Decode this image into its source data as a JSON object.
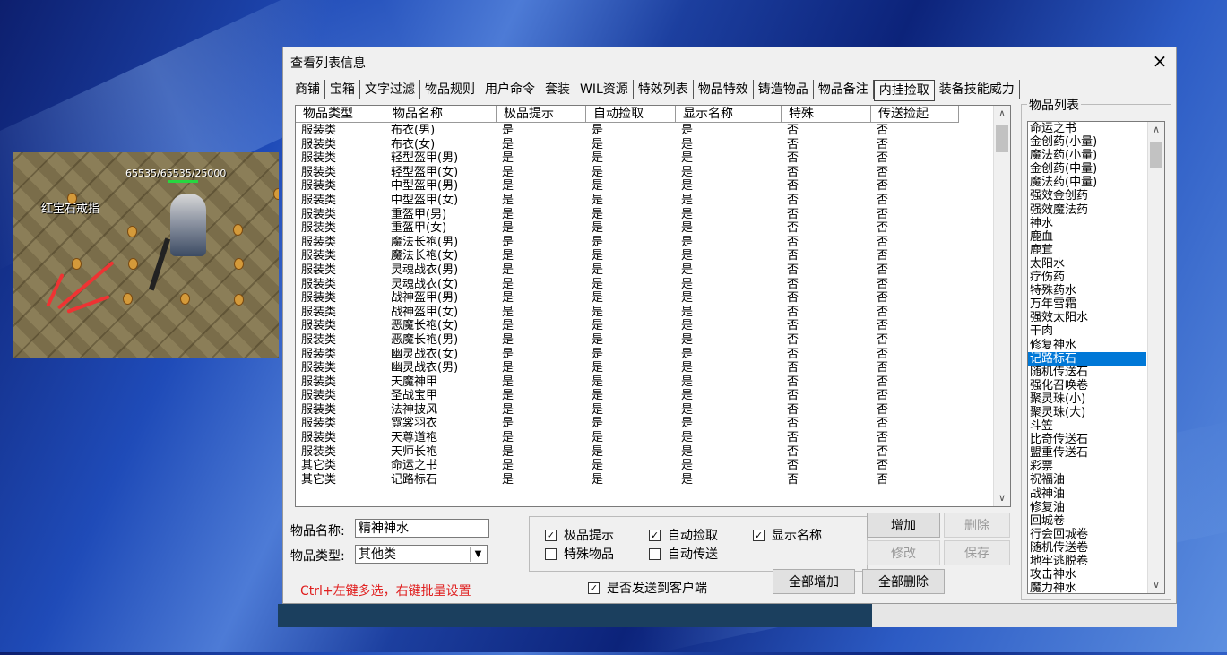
{
  "window": {
    "title": "查看列表信息",
    "close_glyph": "×"
  },
  "tabs": [
    "商铺",
    "宝箱",
    "文字过滤",
    "物品规则",
    "用户命令",
    "套装",
    "WIL资源",
    "特效列表",
    "物品特效",
    "铸造物品",
    "物品备注",
    "内挂捡取",
    "装备技能威力"
  ],
  "active_tab": 11,
  "game": {
    "hp_text": "65535/65535/25000",
    "item_label": "红宝石戒指"
  },
  "grid": {
    "columns": [
      "物品类型",
      "物品名称",
      "极品提示",
      "自动捡取",
      "显示名称",
      "特殊",
      "传送捡起"
    ],
    "rows": [
      [
        "服装类",
        "布衣(男)",
        "是",
        "是",
        "是",
        "否",
        "否"
      ],
      [
        "服装类",
        "布衣(女)",
        "是",
        "是",
        "是",
        "否",
        "否"
      ],
      [
        "服装类",
        "轻型盔甲(男)",
        "是",
        "是",
        "是",
        "否",
        "否"
      ],
      [
        "服装类",
        "轻型盔甲(女)",
        "是",
        "是",
        "是",
        "否",
        "否"
      ],
      [
        "服装类",
        "中型盔甲(男)",
        "是",
        "是",
        "是",
        "否",
        "否"
      ],
      [
        "服装类",
        "中型盔甲(女)",
        "是",
        "是",
        "是",
        "否",
        "否"
      ],
      [
        "服装类",
        "重盔甲(男)",
        "是",
        "是",
        "是",
        "否",
        "否"
      ],
      [
        "服装类",
        "重盔甲(女)",
        "是",
        "是",
        "是",
        "否",
        "否"
      ],
      [
        "服装类",
        "魔法长袍(男)",
        "是",
        "是",
        "是",
        "否",
        "否"
      ],
      [
        "服装类",
        "魔法长袍(女)",
        "是",
        "是",
        "是",
        "否",
        "否"
      ],
      [
        "服装类",
        "灵魂战衣(男)",
        "是",
        "是",
        "是",
        "否",
        "否"
      ],
      [
        "服装类",
        "灵魂战衣(女)",
        "是",
        "是",
        "是",
        "否",
        "否"
      ],
      [
        "服装类",
        "战神盔甲(男)",
        "是",
        "是",
        "是",
        "否",
        "否"
      ],
      [
        "服装类",
        "战神盔甲(女)",
        "是",
        "是",
        "是",
        "否",
        "否"
      ],
      [
        "服装类",
        "恶魔长袍(女)",
        "是",
        "是",
        "是",
        "否",
        "否"
      ],
      [
        "服装类",
        "恶魔长袍(男)",
        "是",
        "是",
        "是",
        "否",
        "否"
      ],
      [
        "服装类",
        "幽灵战衣(女)",
        "是",
        "是",
        "是",
        "否",
        "否"
      ],
      [
        "服装类",
        "幽灵战衣(男)",
        "是",
        "是",
        "是",
        "否",
        "否"
      ],
      [
        "服装类",
        "天魔神甲",
        "是",
        "是",
        "是",
        "否",
        "否"
      ],
      [
        "服装类",
        "圣战宝甲",
        "是",
        "是",
        "是",
        "否",
        "否"
      ],
      [
        "服装类",
        "法神披风",
        "是",
        "是",
        "是",
        "否",
        "否"
      ],
      [
        "服装类",
        "霓裳羽衣",
        "是",
        "是",
        "是",
        "否",
        "否"
      ],
      [
        "服装类",
        "天尊道袍",
        "是",
        "是",
        "是",
        "否",
        "否"
      ],
      [
        "服装类",
        "天师长袍",
        "是",
        "是",
        "是",
        "否",
        "否"
      ],
      [
        "其它类",
        "命运之书",
        "是",
        "是",
        "是",
        "否",
        "否"
      ],
      [
        "其它类",
        "记路标石",
        "是",
        "是",
        "是",
        "否",
        "否"
      ]
    ]
  },
  "right_panel": {
    "title": "物品列表",
    "items": [
      "命运之书",
      "金创药(小量)",
      "魔法药(小量)",
      "金创药(中量)",
      "魔法药(中量)",
      "强效金创药",
      "强效魔法药",
      "神水",
      "鹿血",
      "鹿茸",
      "太阳水",
      "疗伤药",
      "特殊药水",
      "万年雪霜",
      "强效太阳水",
      "干肉",
      "修复神水",
      "记路标石",
      "随机传送石",
      "强化召唤卷",
      "聚灵珠(小)",
      "聚灵珠(大)",
      "斗笠",
      "比奇传送石",
      "盟重传送石",
      "彩票",
      "祝福油",
      "战神油",
      "修复油",
      "回城卷",
      "行会回城卷",
      "随机传送卷",
      "地牢逃脱卷",
      "攻击神水",
      "魔力神水"
    ],
    "selected_index": 17
  },
  "form": {
    "name_label": "物品名称:",
    "name_value": "精神神水",
    "type_label": "物品类型:",
    "type_value": "其他类",
    "checkboxes": [
      {
        "label": "极品提示",
        "checked": true
      },
      {
        "label": "自动捡取",
        "checked": true
      },
      {
        "label": "显示名称",
        "checked": true
      },
      {
        "label": "特殊物品",
        "checked": false
      },
      {
        "label": "自动传送",
        "checked": false
      }
    ],
    "send_client": {
      "label": "是否发送到客户端",
      "checked": true
    },
    "buttons": {
      "add": "增加",
      "delete": "删除",
      "modify": "修改",
      "save": "保存",
      "add_all": "全部增加",
      "delete_all": "全部删除"
    },
    "hint": "Ctrl+左键多选，右键批量设置"
  }
}
